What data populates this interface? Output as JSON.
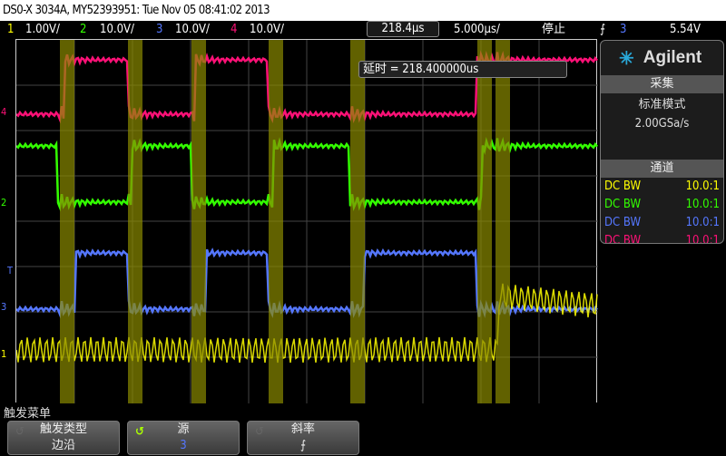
{
  "title": "DS0-X 3034A, MY52393951: Tue Nov 05 08:41:02 2013",
  "status": {
    "channels": [
      {
        "num": "1",
        "scale": "1.00V/"
      },
      {
        "num": "2",
        "scale": "10.0V/"
      },
      {
        "num": "3",
        "scale": "10.0V/"
      },
      {
        "num": "4",
        "scale": "10.0V/"
      }
    ],
    "delay": "218.4µs",
    "timebase": "5.000µs/",
    "run_state": "停止",
    "trigger_slope": "⨍",
    "trigger_source": "3",
    "trigger_level": "5.54V"
  },
  "delay_readout": "延时 = 218.400000us",
  "side": {
    "brand": "Agilent",
    "acq_title": "采集",
    "acq_mode": "标准模式",
    "sample_rate": "2.00GSa/s",
    "chan_title": "通道",
    "channels": [
      {
        "coupling": "DC BW",
        "probe": "10.0:1",
        "color": "#ffff00"
      },
      {
        "coupling": "DC BW",
        "probe": "10.0:1",
        "color": "#33ff00"
      },
      {
        "coupling": "DC BW",
        "probe": "10.0:1",
        "color": "#5577ff"
      },
      {
        "coupling": "DC BW",
        "probe": "10.0:1",
        "color": "#ff1177"
      }
    ]
  },
  "markers": {
    "ch4": "4",
    "ch2": "2",
    "trigger": "T",
    "ch3": "3",
    "ch1": "1"
  },
  "menu": {
    "title": "触发菜单",
    "softkeys": [
      {
        "label": "触发类型",
        "value": "边沿"
      },
      {
        "label": "源",
        "value": "3"
      },
      {
        "label": "斜率",
        "value": "⨍"
      }
    ]
  },
  "colors": {
    "ch1": "#ffff00",
    "ch2": "#33ff00",
    "ch3": "#5577ff",
    "ch4": "#ff1177"
  }
}
